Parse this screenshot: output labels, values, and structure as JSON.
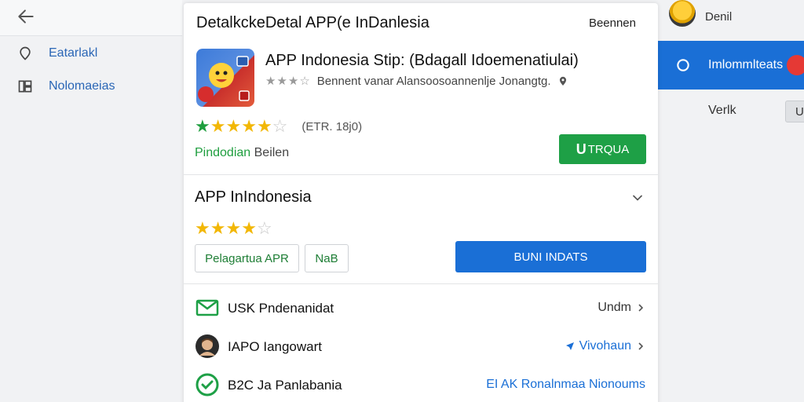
{
  "sidebar": {
    "items": [
      {
        "label": "Eatarlakl",
        "icon": "location-pin-icon"
      },
      {
        "label": "Nolomaeias",
        "icon": "grid-icon"
      }
    ]
  },
  "right_panel": {
    "user_name": "Denil",
    "highlight_label": "Imlommlteats",
    "secondary_label": "Verlk",
    "chip_label": "U"
  },
  "card": {
    "title": "DetalkckeDetal APP(e InDanlesia",
    "header_right": "Beennen",
    "app": {
      "name": "APP Indonesia Stip: (Bdagall Idoemenatiulai)",
      "meta_text": "Bennent vanar Alansoosoannenlje Jonangtg.",
      "rating_count": "(ETR. 18j0)",
      "developer_prefix": "Pindodian",
      "developer_suffix": " Beilen",
      "install_icon_text": "U",
      "install_label": "TRQUA"
    },
    "section": {
      "title": "APP InIndonesia",
      "btn_outline_1": "Pelagartua APR",
      "btn_outline_2": "NaB",
      "btn_primary": "BUNI INDATS"
    },
    "rows": [
      {
        "label": "USK Pndenanidat",
        "value": "Undm",
        "icon": "mail-icon"
      },
      {
        "label": "IAPO Iangowart",
        "value": "Vivohaun",
        "icon": "person-avatar-icon"
      },
      {
        "label": "B2C Ja Panlabania",
        "value": "EI AK Ronalnmaa Nionoums",
        "icon": "check-circle-icon"
      }
    ]
  },
  "ratings": {
    "main_stars": 4.5,
    "section_stars": 4
  },
  "colors": {
    "accent_blue": "#1a6fd6",
    "accent_green": "#1ea046",
    "star_gold": "#f2b705"
  }
}
